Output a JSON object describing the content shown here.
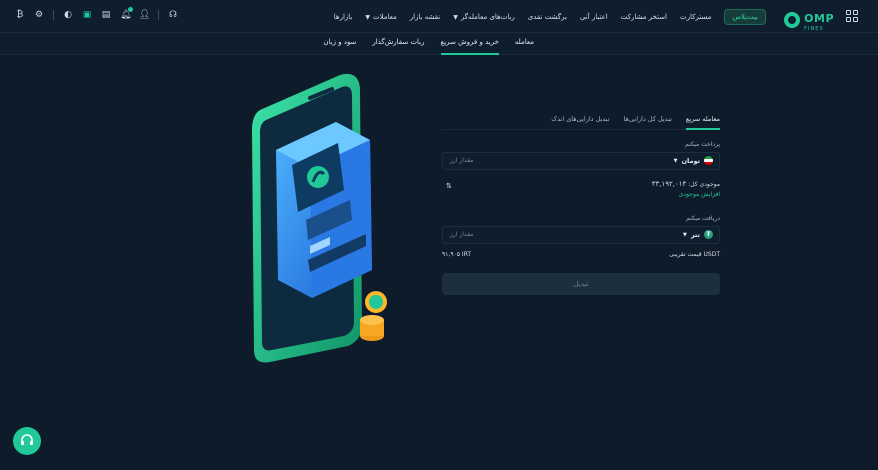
{
  "brand": {
    "name": "OMP",
    "sub": "FINEX"
  },
  "nav": {
    "markets": "بازارها",
    "trades": "معاملات",
    "market_map": "نقشه بازار",
    "bots": "ربات‌های معامله‌گر",
    "cashback": "برگشت نقدی",
    "instant_credit": "اعتبار آنی",
    "staking": "استخر مشارکت",
    "copytrade": "مستر‌کارت",
    "pill": "بیت‌پلاس"
  },
  "subnav": {
    "pnl": "سود و زیان",
    "order_bot": "ربات سفارش‌گذار",
    "quick_trade": "خرید و فروش سریع",
    "trade": "معامله"
  },
  "form": {
    "tabs": {
      "quick": "معامله سریع",
      "convert_all": "تبدیل کل دارایی‌ها",
      "convert_small": "تبدیل دارایی‌های اندک"
    },
    "pay_label": "پرداخت میکنم",
    "pay_currency": "تومان",
    "pay_placeholder": "مقدار ارز",
    "balance_label": "موجودی کل:",
    "balance_value": "۳۳,۱۹۲,۰۱۴",
    "increase_balance": "افزایش موجودی",
    "receive_label": "دریافت میکنم",
    "receive_currency": "تتر",
    "receive_placeholder": "مقدار ارز",
    "approx_price_label": "قیمت تقریبی USDT",
    "approx_price_value": "۹۱,۹۰۵ IRT",
    "submit_label": "تبدیل"
  },
  "colors": {
    "accent": "#20c997",
    "background": "#0d1b2a"
  }
}
